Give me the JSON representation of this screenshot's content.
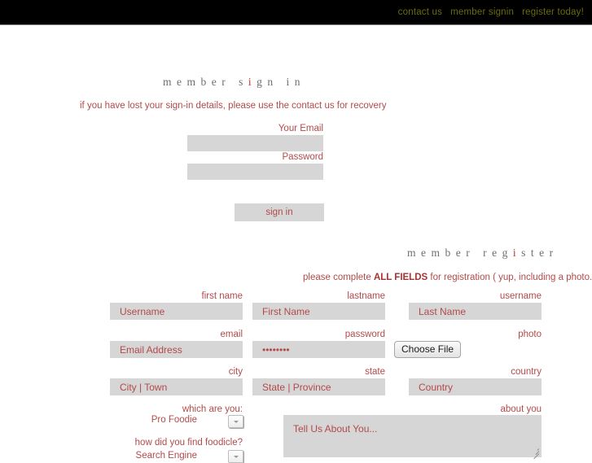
{
  "topbar": {
    "links": [
      {
        "label": "contact us"
      },
      {
        "label": "member signin"
      },
      {
        "label": "register today!"
      }
    ],
    "link_color": "#6b6b0c",
    "background": "#000000"
  },
  "colors": {
    "accent_red": "#b24a4a",
    "heading_gray": "#6e6e6e",
    "input_gray": "#d6d6d6",
    "page_background": "#ffffff"
  },
  "signin": {
    "heading_parts": [
      {
        "text": "member s",
        "highlight": false
      },
      {
        "text": "i",
        "highlight": true
      },
      {
        "text": "gn in",
        "highlight": false
      }
    ],
    "heading_plain": "member sign in",
    "notice": "if you have lost your sign-in details, please use the contact us for recovery",
    "email": {
      "label": "Your Email",
      "value": "",
      "placeholder": ""
    },
    "password": {
      "label": "Password",
      "value": "",
      "placeholder": ""
    },
    "submit_label": "sign in"
  },
  "register": {
    "heading_parts": [
      {
        "text": "member reg",
        "highlight": false
      },
      {
        "text": "i",
        "highlight": true
      },
      {
        "text": "ster",
        "highlight": false
      }
    ],
    "heading_plain": "member register",
    "notice_pre": "please complete ",
    "notice_bold": "ALL FIELDS",
    "notice_post": " for registration ( yup, including a photo. ) Thanks!",
    "row1": [
      {
        "label": "first name",
        "placeholder": "Username",
        "value": ""
      },
      {
        "label": "lastname",
        "placeholder": "First Name",
        "value": ""
      },
      {
        "label": "username",
        "placeholder": "Last Name",
        "value": ""
      }
    ],
    "row2": {
      "email": {
        "label": "email",
        "placeholder": "Email Address",
        "value": ""
      },
      "password": {
        "label": "password",
        "placeholder": "",
        "value": "........"
      },
      "photo": {
        "label": "photo",
        "button_label": "Choose File"
      }
    },
    "row3": [
      {
        "label": "city",
        "placeholder": "City | Town",
        "value": ""
      },
      {
        "label": "state",
        "placeholder": "State | Province",
        "value": ""
      },
      {
        "label": "country",
        "placeholder": "Country",
        "value": ""
      }
    ],
    "which_are_you": {
      "label": "which are you:",
      "selected": "Pro Foodie",
      "options": [
        "Pro Foodie"
      ]
    },
    "how_found": {
      "label": "how did you find foodicle?",
      "selected": "Search Engine",
      "options": [
        "Search Engine"
      ]
    },
    "about_you": {
      "label": "about you",
      "placeholder": "Tell Us About You...",
      "value": ""
    }
  }
}
